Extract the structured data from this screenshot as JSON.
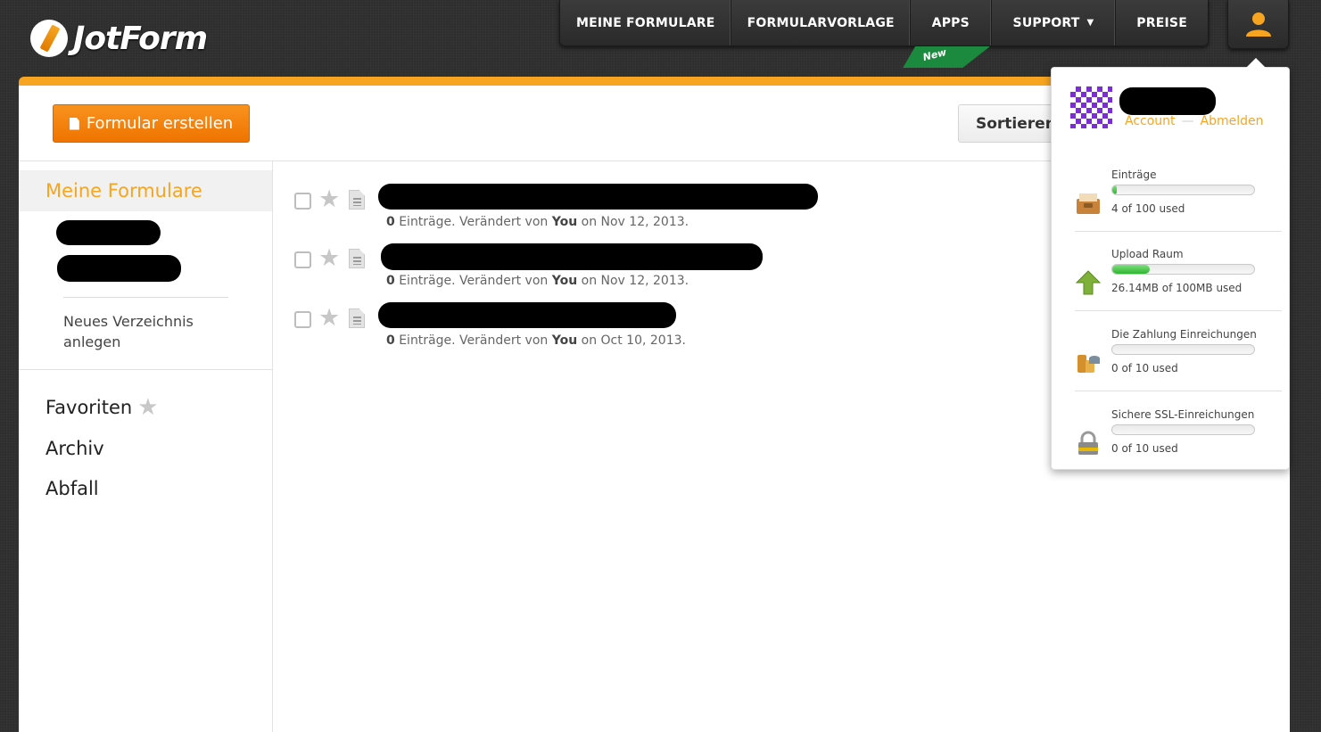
{
  "brand": {
    "name": "JotForm"
  },
  "topnav": {
    "items": [
      {
        "label": "MEINE FORMULARE"
      },
      {
        "label": "FORMULARVORLAGE"
      },
      {
        "label": "APPS"
      },
      {
        "label": "SUPPORT",
        "caret": "▼"
      },
      {
        "label": "PREISE"
      }
    ],
    "new_badge": "New",
    "user_icon": "user-icon"
  },
  "toolbar": {
    "create_label": "Formular erstellen",
    "sort_label": "Sortieren",
    "sort_caret": "▼"
  },
  "sidebar": {
    "active": "Meine Formulare",
    "new_folder": "Neues Verzeichnis anlegen",
    "links": [
      {
        "label": "Favoriten",
        "icon": "star-icon"
      },
      {
        "label": "Archiv"
      },
      {
        "label": "Abfall"
      }
    ]
  },
  "forms": [
    {
      "entries": "0",
      "entries_label": "Einträge. Verändert von",
      "by": "You",
      "date": "on Nov 12, 2013."
    },
    {
      "entries": "0",
      "entries_label": "Einträge. Verändert von",
      "by": "You",
      "date": "on Nov 12, 2013."
    },
    {
      "entries": "0",
      "entries_label": "Einträge. Verändert von",
      "by": "You",
      "date": "on Oct 10, 2013."
    }
  ],
  "account": {
    "account_link": "Account",
    "separator": "—",
    "logout_link": "Abmelden",
    "quotas": [
      {
        "label": "Einträge",
        "used": "4 of 100 used",
        "fraction": 0.04,
        "icon": "inbox-icon"
      },
      {
        "label": "Upload Raum",
        "used": "26.14MB of 100MB used",
        "fraction": 0.2614,
        "icon": "upload-arrow-icon"
      },
      {
        "label": "Die Zahlung Einreichungen",
        "used": "0 of 10 used",
        "fraction": 0,
        "icon": "coins-icon"
      },
      {
        "label": "Sichere SSL-Einreichungen",
        "used": "0 of 10 used",
        "fraction": 0,
        "icon": "lock-icon"
      }
    ]
  },
  "colors": {
    "accent": "#f7a520",
    "button_orange": "#f57f0a",
    "progress_green": "#2fb52f",
    "nav_bg": "#333333"
  }
}
